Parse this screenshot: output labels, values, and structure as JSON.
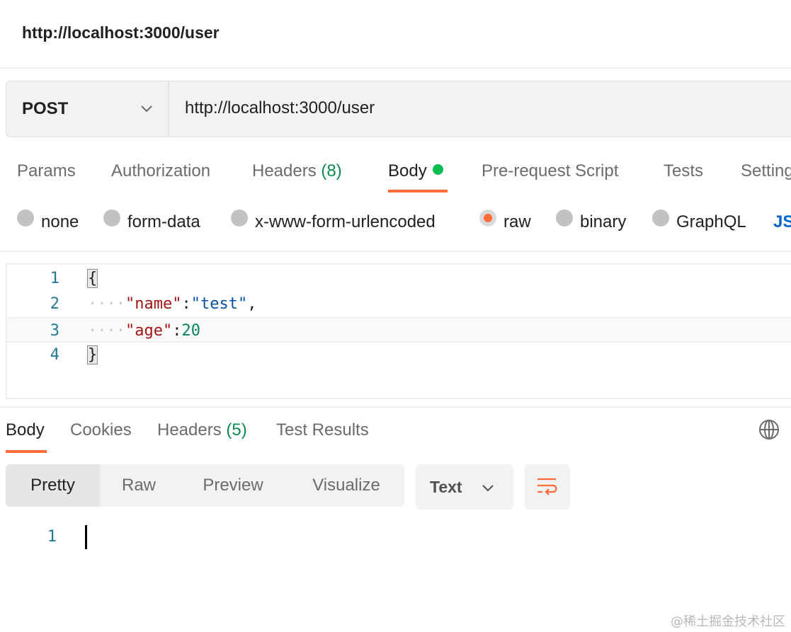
{
  "header": {
    "title": "http://localhost:3000/user"
  },
  "request": {
    "method": "POST",
    "url": "http://localhost:3000/user"
  },
  "request_tabs": {
    "params": "Params",
    "authorization": "Authorization",
    "headers_label": "Headers",
    "headers_count": "(8)",
    "body": "Body",
    "prerequest": "Pre-request Script",
    "tests": "Tests",
    "settings": "Setting"
  },
  "body_types": {
    "none": "none",
    "form_data": "form-data",
    "urlencoded": "x-www-form-urlencoded",
    "raw": "raw",
    "binary": "binary",
    "graphql": "GraphQL",
    "json": "JS",
    "selected": "raw"
  },
  "editor": {
    "lines": [
      {
        "num": "1",
        "open_brace": "{"
      },
      {
        "num": "2",
        "indent": "····",
        "key": "\"name\"",
        "colon": ":",
        "value": "\"test\"",
        "trail": ","
      },
      {
        "num": "3",
        "indent": "····",
        "key": "\"age\"",
        "colon": ":",
        "value": "20"
      },
      {
        "num": "4",
        "close_brace": "}"
      }
    ]
  },
  "response_tabs": {
    "body": "Body",
    "cookies": "Cookies",
    "headers_label": "Headers",
    "headers_count": "(5)",
    "test_results": "Test Results"
  },
  "view_modes": {
    "pretty": "Pretty",
    "raw": "Raw",
    "preview": "Preview",
    "visualize": "Visualize",
    "selected": "Pretty"
  },
  "format": {
    "label": "Text"
  },
  "response": {
    "line_num": "1"
  },
  "watermark": "@稀土掘金技术社区",
  "colors": {
    "accent": "#ff6c37",
    "body_indicator": "#0cbb52",
    "count": "#0f8a4f",
    "link": "#0265d2"
  },
  "icons": {
    "method_dropdown": "chevron-down-icon",
    "globe": "globe-icon",
    "wrap": "word-wrap-icon",
    "format_dropdown": "chevron-down-icon"
  }
}
